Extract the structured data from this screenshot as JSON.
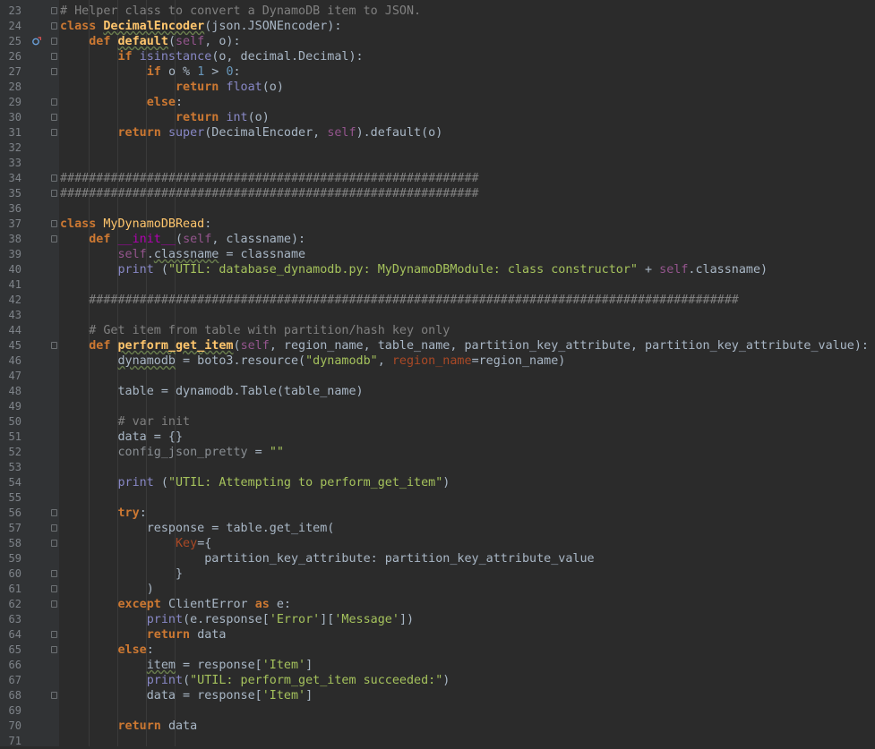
{
  "editor": {
    "colors": {
      "background": "#2b2b2b",
      "gutter": "#313335",
      "keyword": "#cc7832",
      "function": "#ffc66d",
      "string": "#a5c25c",
      "number": "#6897bb",
      "self": "#94558d",
      "builtin": "#8888c6",
      "comment": "#808080",
      "magic": "#b200b2",
      "named_param": "#aa4926",
      "text": "#a9b7c6"
    },
    "gutter_icons": [
      "override-method-icon",
      "fold-marker-icon"
    ],
    "lines": [
      {
        "n": "23",
        "fold": "start",
        "tokens": [
          {
            "t": "# Helper class to convert a DynamoDB item to JSON.",
            "c": "cm"
          }
        ]
      },
      {
        "n": "24",
        "fold": "start",
        "tokens": [
          {
            "t": "class ",
            "c": "kw"
          },
          {
            "t": "DecimalEncoder",
            "c": "def"
          },
          {
            "t": "(json.JSONEncoder):",
            "c": "op"
          }
        ]
      },
      {
        "n": "25",
        "fold": "start",
        "marker": true,
        "tokens": [
          {
            "t": "    def ",
            "c": "kw"
          },
          {
            "t": "default",
            "c": "def"
          },
          {
            "t": "(",
            "c": "op"
          },
          {
            "t": "self",
            "c": "self"
          },
          {
            "t": ", o):",
            "c": "op"
          }
        ]
      },
      {
        "n": "26",
        "fold": "start",
        "tokens": [
          {
            "t": "        if ",
            "c": "kw"
          },
          {
            "t": "isinstance",
            "c": "bi"
          },
          {
            "t": "(o, decimal.Decimal):",
            "c": "op"
          }
        ]
      },
      {
        "n": "27",
        "fold": "start",
        "tokens": [
          {
            "t": "            if ",
            "c": "kw"
          },
          {
            "t": "o % ",
            "c": "op"
          },
          {
            "t": "1",
            "c": "num"
          },
          {
            "t": " > ",
            "c": "op"
          },
          {
            "t": "0",
            "c": "num"
          },
          {
            "t": ":",
            "c": "op"
          }
        ]
      },
      {
        "n": "28",
        "tokens": [
          {
            "t": "                return ",
            "c": "kw"
          },
          {
            "t": "float",
            "c": "bi"
          },
          {
            "t": "(o)",
            "c": "op"
          }
        ]
      },
      {
        "n": "29",
        "fold": "start",
        "tokens": [
          {
            "t": "            else",
            "c": "kw"
          },
          {
            "t": ":",
            "c": "op"
          }
        ]
      },
      {
        "n": "30",
        "fold": "end",
        "tokens": [
          {
            "t": "                return ",
            "c": "kw"
          },
          {
            "t": "int",
            "c": "bi"
          },
          {
            "t": "(o)",
            "c": "op"
          }
        ]
      },
      {
        "n": "31",
        "fold": "end",
        "tokens": [
          {
            "t": "        return ",
            "c": "kw"
          },
          {
            "t": "super",
            "c": "bi"
          },
          {
            "t": "(DecimalEncoder, ",
            "c": "op"
          },
          {
            "t": "self",
            "c": "self"
          },
          {
            "t": ").default(o)",
            "c": "op"
          }
        ]
      },
      {
        "n": "32",
        "tokens": []
      },
      {
        "n": "33",
        "tokens": []
      },
      {
        "n": "34",
        "fold": "start",
        "tokens": [
          {
            "t": "##########################################################",
            "c": "cm"
          }
        ]
      },
      {
        "n": "35",
        "fold": "end",
        "tokens": [
          {
            "t": "##########################################################",
            "c": "cm"
          }
        ]
      },
      {
        "n": "36",
        "tokens": []
      },
      {
        "n": "37",
        "fold": "start",
        "tokens": [
          {
            "t": "class ",
            "c": "kw"
          },
          {
            "t": "MyDynamoDBRead",
            "c": "fn"
          },
          {
            "t": ":",
            "c": "op"
          }
        ]
      },
      {
        "n": "38",
        "fold": "start",
        "tokens": [
          {
            "t": "    def ",
            "c": "kw"
          },
          {
            "t": "__init__",
            "c": "mg"
          },
          {
            "t": "(",
            "c": "op"
          },
          {
            "t": "self",
            "c": "self"
          },
          {
            "t": ", classname):",
            "c": "op"
          }
        ]
      },
      {
        "n": "39",
        "tokens": [
          {
            "t": "        ",
            "c": "op"
          },
          {
            "t": "self",
            "c": "self"
          },
          {
            "t": ".",
            "c": "op"
          },
          {
            "t": "classname",
            "c": "wavy"
          },
          {
            "t": " = classname",
            "c": "op"
          }
        ]
      },
      {
        "n": "40",
        "tokens": [
          {
            "t": "        ",
            "c": "op"
          },
          {
            "t": "print ",
            "c": "bi"
          },
          {
            "t": "(",
            "c": "op"
          },
          {
            "t": "\"UTIL: database_dynamodb.py: MyDynamoDBModule: class constructor\"",
            "c": "str"
          },
          {
            "t": " + ",
            "c": "op"
          },
          {
            "t": "self",
            "c": "self"
          },
          {
            "t": ".classname)",
            "c": "op"
          }
        ]
      },
      {
        "n": "41",
        "tokens": []
      },
      {
        "n": "42",
        "tokens": [
          {
            "t": "    ##########################################################################################",
            "c": "cm"
          }
        ]
      },
      {
        "n": "43",
        "tokens": []
      },
      {
        "n": "44",
        "tokens": [
          {
            "t": "    # Get item from table with partition/hash key only",
            "c": "cm"
          }
        ]
      },
      {
        "n": "45",
        "fold": "start",
        "tokens": [
          {
            "t": "    def ",
            "c": "kw"
          },
          {
            "t": "perform_get_item",
            "c": "def"
          },
          {
            "t": "(",
            "c": "op"
          },
          {
            "t": "self",
            "c": "self"
          },
          {
            "t": ", region_name, table_name, partition_key_attribute, partition_key_attribute_value):",
            "c": "op"
          }
        ]
      },
      {
        "n": "46",
        "tokens": [
          {
            "t": "        ",
            "c": "op"
          },
          {
            "t": "dynamodb",
            "c": "wavy"
          },
          {
            "t": " = boto3.resource(",
            "c": "op"
          },
          {
            "t": "\"dynamodb\"",
            "c": "str"
          },
          {
            "t": ", ",
            "c": "op"
          },
          {
            "t": "region_name",
            "c": "param"
          },
          {
            "t": "=region_name)",
            "c": "op"
          }
        ]
      },
      {
        "n": "47",
        "tokens": []
      },
      {
        "n": "48",
        "tokens": [
          {
            "t": "        table = dynamodb.Table(table_name)",
            "c": "op"
          }
        ]
      },
      {
        "n": "49",
        "tokens": []
      },
      {
        "n": "50",
        "tokens": [
          {
            "t": "        # var init",
            "c": "cm"
          }
        ]
      },
      {
        "n": "51",
        "tokens": [
          {
            "t": "        data = {}",
            "c": "op"
          }
        ]
      },
      {
        "n": "52",
        "tokens": [
          {
            "t": "        ",
            "c": "op"
          },
          {
            "t": "config_json_pretty",
            "c": "dim"
          },
          {
            "t": " = ",
            "c": "op"
          },
          {
            "t": "\"\"",
            "c": "str"
          }
        ]
      },
      {
        "n": "53",
        "tokens": []
      },
      {
        "n": "54",
        "tokens": [
          {
            "t": "        ",
            "c": "op"
          },
          {
            "t": "print ",
            "c": "bi"
          },
          {
            "t": "(",
            "c": "op"
          },
          {
            "t": "\"UTIL: Attempting to perform_get_item\"",
            "c": "str"
          },
          {
            "t": ")",
            "c": "op"
          }
        ]
      },
      {
        "n": "55",
        "tokens": []
      },
      {
        "n": "56",
        "fold": "start",
        "tokens": [
          {
            "t": "        try",
            "c": "kw"
          },
          {
            "t": ":",
            "c": "op"
          }
        ]
      },
      {
        "n": "57",
        "fold": "start",
        "tokens": [
          {
            "t": "            response = table.get_item(",
            "c": "op"
          }
        ]
      },
      {
        "n": "58",
        "fold": "start",
        "tokens": [
          {
            "t": "                ",
            "c": "op"
          },
          {
            "t": "Key",
            "c": "param"
          },
          {
            "t": "={",
            "c": "op"
          }
        ]
      },
      {
        "n": "59",
        "tokens": [
          {
            "t": "                    partition_key_attribute: partition_key_attribute_value",
            "c": "op"
          }
        ]
      },
      {
        "n": "60",
        "fold": "end",
        "tokens": [
          {
            "t": "                }",
            "c": "op"
          }
        ]
      },
      {
        "n": "61",
        "fold": "end",
        "tokens": [
          {
            "t": "            )",
            "c": "op"
          }
        ]
      },
      {
        "n": "62",
        "fold": "start",
        "tokens": [
          {
            "t": "        except ",
            "c": "kw"
          },
          {
            "t": "ClientError ",
            "c": "op"
          },
          {
            "t": "as ",
            "c": "kw"
          },
          {
            "t": "e:",
            "c": "op"
          }
        ]
      },
      {
        "n": "63",
        "tokens": [
          {
            "t": "            ",
            "c": "op"
          },
          {
            "t": "print",
            "c": "bi"
          },
          {
            "t": "(e.response[",
            "c": "op"
          },
          {
            "t": "'Error'",
            "c": "str"
          },
          {
            "t": "][",
            "c": "op"
          },
          {
            "t": "'Message'",
            "c": "str"
          },
          {
            "t": "])",
            "c": "op"
          }
        ]
      },
      {
        "n": "64",
        "fold": "end",
        "tokens": [
          {
            "t": "            return ",
            "c": "kw"
          },
          {
            "t": "data",
            "c": "op"
          }
        ]
      },
      {
        "n": "65",
        "fold": "start",
        "tokens": [
          {
            "t": "        else",
            "c": "kw"
          },
          {
            "t": ":",
            "c": "op"
          }
        ]
      },
      {
        "n": "66",
        "tokens": [
          {
            "t": "            ",
            "c": "op"
          },
          {
            "t": "item",
            "c": "wavy"
          },
          {
            "t": " = response[",
            "c": "op"
          },
          {
            "t": "'Item'",
            "c": "str"
          },
          {
            "t": "]",
            "c": "op"
          }
        ]
      },
      {
        "n": "67",
        "tokens": [
          {
            "t": "            ",
            "c": "op"
          },
          {
            "t": "print",
            "c": "bi"
          },
          {
            "t": "(",
            "c": "op"
          },
          {
            "t": "\"UTIL: perform_get_item succeeded:\"",
            "c": "str"
          },
          {
            "t": ")",
            "c": "op"
          }
        ]
      },
      {
        "n": "68",
        "fold": "end",
        "tokens": [
          {
            "t": "            data = response[",
            "c": "op"
          },
          {
            "t": "'Item'",
            "c": "str"
          },
          {
            "t": "]",
            "c": "op"
          }
        ]
      },
      {
        "n": "69",
        "tokens": []
      },
      {
        "n": "70",
        "tokens": [
          {
            "t": "        return ",
            "c": "kw"
          },
          {
            "t": "data",
            "c": "op"
          }
        ]
      },
      {
        "n": "71",
        "tokens": []
      }
    ]
  }
}
